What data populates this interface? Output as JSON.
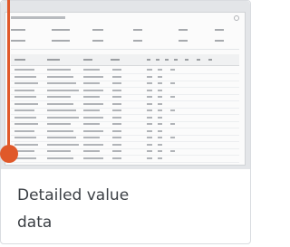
{
  "card": {
    "caption": "Detailed value\ndata",
    "thumbnail_icon": "report-table-preview"
  },
  "colors": {
    "accent": "#e0592a",
    "caption_text": "#3b3f44",
    "thumbnail_bg": "#e3e5e8",
    "card_border": "#d9dce0"
  }
}
